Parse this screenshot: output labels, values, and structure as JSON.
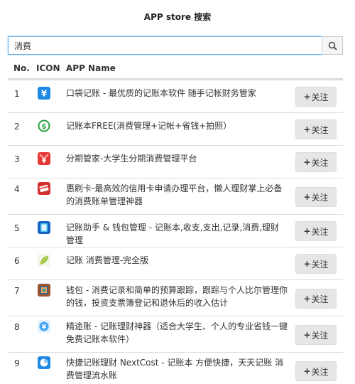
{
  "page_title": "APP store 搜索",
  "search": {
    "value": "消费",
    "button_icon": "search-icon"
  },
  "table": {
    "headers": {
      "no": "No.",
      "icon": "ICON",
      "name": "APP Name"
    },
    "follow_label": "关注",
    "rows": [
      {
        "no": "1",
        "icon": "yen-icon",
        "color": "#1e88e5",
        "name": "口袋记账 - 最优质的记账本软件 随手记帐财务管家"
      },
      {
        "no": "2",
        "icon": "dollar-coin-icon",
        "color": "#2e9e44",
        "name": "记账本FREE(消费管理+记帐+省钱+拍照）"
      },
      {
        "no": "3",
        "icon": "yen-badge-icon",
        "color": "#e53935",
        "name": "分期管家-大学生分期消费管理平台"
      },
      {
        "no": "4",
        "icon": "credit-card-icon",
        "color": "#d32f2f",
        "name": "惠刷卡-最高效的信用卡申请办理平台，懒人理财掌上必备的消费账单管理神器"
      },
      {
        "no": "5",
        "icon": "wallet-icon",
        "color": "#1565c0",
        "name": "记账助手 & 钱包管理 - 记账本,收支,支出,记录,消费,理财管理"
      },
      {
        "no": "6",
        "icon": "leaf-icon",
        "color": "#8bc34a",
        "name": "记账 消费管理-完全版"
      },
      {
        "no": "7",
        "icon": "book-icon",
        "color": "#a0522d",
        "name": "钱包 - 消费记录和简单的预算跟踪，跟踪与个人比尔管理你的钱，投资支票簿登记和退休后的收入估计"
      },
      {
        "no": "8",
        "icon": "coin-circle-icon",
        "color": "#42a5f5",
        "name": "精途账 - 记账理财神器（适合大学生、个人的专业省钱一键免费记账本软件）"
      },
      {
        "no": "9",
        "icon": "pie-chart-icon",
        "color": "#1e88e5",
        "name": "快捷记账理财 NextCost - 记账本 方便快捷，天天记账 消费管理流水账"
      }
    ]
  }
}
